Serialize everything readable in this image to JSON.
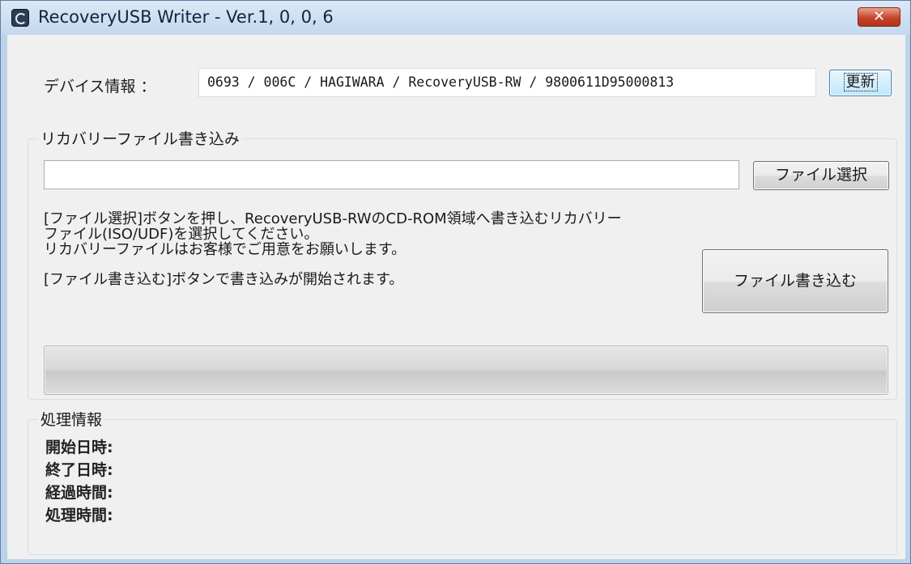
{
  "window": {
    "title": "RecoveryUSB Writer - Ver.1, 0, 0, 6",
    "close_label": "✕"
  },
  "device": {
    "label": "デバイス情報 ：",
    "value": "0693 / 006C / HAGIWARA / RecoveryUSB-RW / 9800611D95000813",
    "refresh_label": "更新"
  },
  "recovery": {
    "group_label": "リカバリーファイル書き込み",
    "file_path": "",
    "select_button_label": "ファイル選択",
    "write_button_label": "ファイル書き込む",
    "instructions": [
      "[ファイル選択]ボタンを押し、RecoveryUSB-RWのCD-ROM領域へ書き込むリカバリー",
      "ファイル(ISO/UDF)を選択してください。",
      "リカバリーファイルはお客様でご用意をお願いします。",
      "[ファイル書き込む]ボタンで書き込みが開始されます。"
    ],
    "progress": 0
  },
  "processing": {
    "group_label": "処理情報",
    "start_label": "開始日時:",
    "end_label": "終了日時:",
    "elapsed_label": "経過時間:",
    "processing_time_label": "処理時間:"
  }
}
